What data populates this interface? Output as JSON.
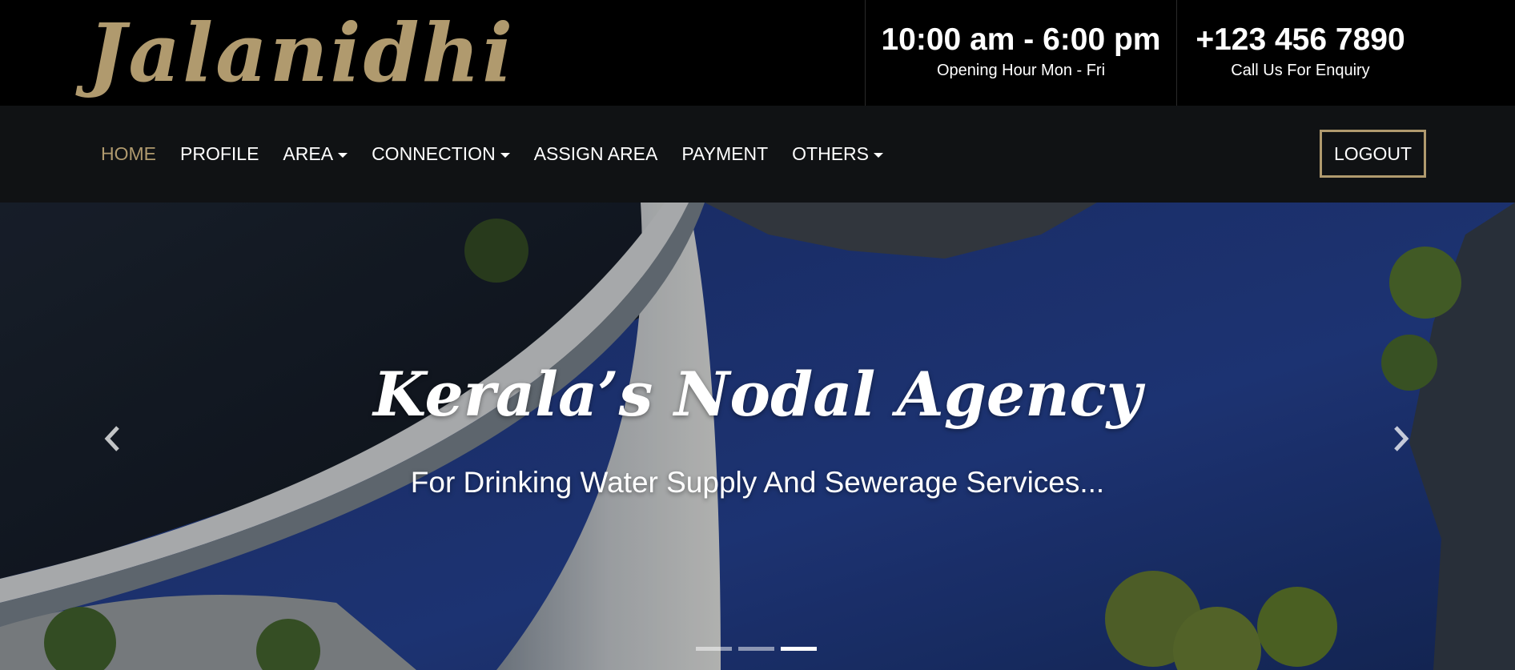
{
  "brand": {
    "logo_text": "Jalanidhi",
    "accent_color": "#b09a6e"
  },
  "header": {
    "hours": {
      "main": "10:00 am - 6:00 pm",
      "sub": "Opening Hour Mon - Fri"
    },
    "phone": {
      "main": "+123 456 7890",
      "sub": "Call Us For Enquiry"
    }
  },
  "nav": {
    "items": [
      {
        "label": "HOME",
        "active": true,
        "dropdown": false
      },
      {
        "label": "PROFILE",
        "active": false,
        "dropdown": false
      },
      {
        "label": "AREA",
        "active": false,
        "dropdown": true
      },
      {
        "label": "CONNECTION",
        "active": false,
        "dropdown": true
      },
      {
        "label": "ASSIGN AREA",
        "active": false,
        "dropdown": false
      },
      {
        "label": "PAYMENT",
        "active": false,
        "dropdown": false
      },
      {
        "label": "OTHERS",
        "active": false,
        "dropdown": true
      }
    ],
    "logout_label": "LOGOUT"
  },
  "hero": {
    "title": "Kerala’s Nodal Agency",
    "subtitle": "For Drinking Water Supply And Sewerage Services...",
    "slide_count": 3,
    "active_slide": 3,
    "prev_icon": "chevron-left-icon",
    "next_icon": "chevron-right-icon"
  }
}
